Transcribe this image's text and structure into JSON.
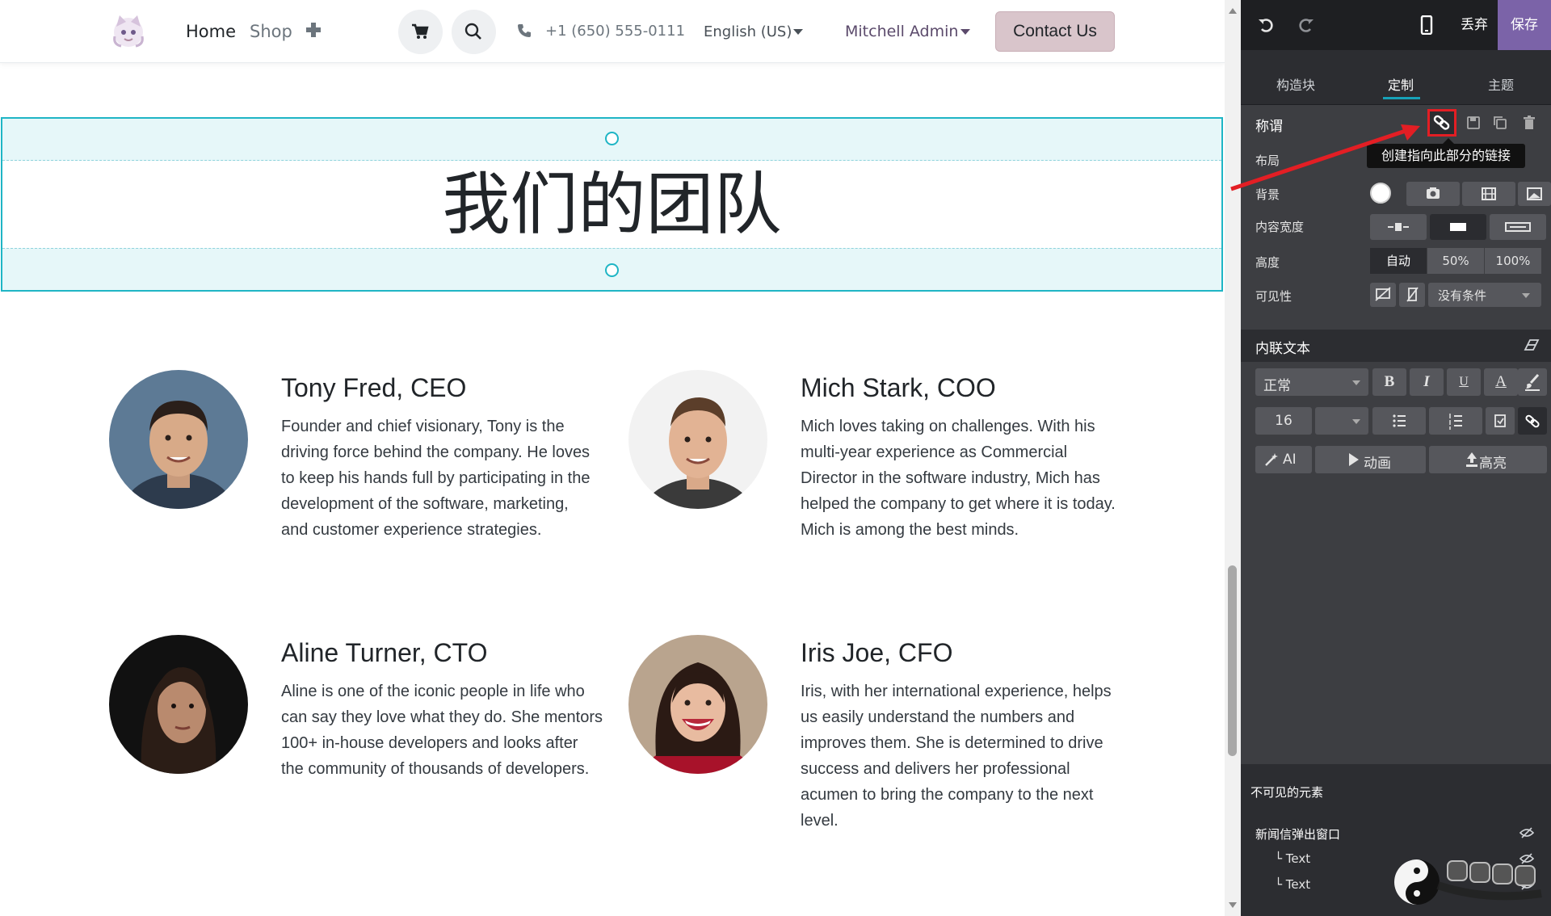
{
  "nav": {
    "home": "Home",
    "shop": "Shop",
    "phone": "+1 (650) 555-0111",
    "language": "English (US)",
    "user": "Mitchell Admin",
    "contact": "Contact Us",
    "icons": [
      "logo",
      "plus-icon",
      "cart-icon",
      "search-icon",
      "phone-icon",
      "caret-down-icon"
    ]
  },
  "section": {
    "title": "我们的团队"
  },
  "team": [
    {
      "name": "Tony Fred, CEO",
      "description": "Founder and chief visionary, Tony is the driving force behind the company. He loves to keep his hands full by participating in the development of the software, marketing, and customer experience strategies."
    },
    {
      "name": "Mich Stark, COO",
      "description": "Mich loves taking on challenges. With his multi-year experience as Commercial Director in the software industry, Mich has helped the company to get where it is today. Mich is among the best minds."
    },
    {
      "name": "Aline Turner, CTO",
      "description": "Aline is one of the iconic people in life who can say they love what they do. She mentors 100+ in-house developers and looks after the community of thousands of developers."
    },
    {
      "name": "Iris Joe, CFO",
      "description": "Iris, with her international experience, helps us easily understand the numbers and improves them. She is determined to drive success and delivers her professional acumen to bring the company to the next level."
    }
  ],
  "panel": {
    "discard": "丢弃",
    "save": "保存",
    "tabs": [
      "构造块",
      "定制",
      "主题"
    ],
    "options_title": "称谓",
    "tooltip": "创建指向此部分的链接",
    "labels": {
      "layout": "布局",
      "background": "背景",
      "content_width": "内容宽度",
      "height": "高度",
      "visibility": "可见性"
    },
    "height_options": [
      "自动",
      "50%",
      "100%"
    ],
    "visibility_value": "没有条件",
    "inline_text": "内联文本",
    "format_style": "正常",
    "format_buttons": [
      "B",
      "I",
      "U",
      "A"
    ],
    "font_size": "16",
    "ai": "AI",
    "animation": "动画",
    "highlight": "高亮",
    "invisible_title": "不可见的元素",
    "invisible_items": [
      "新闻信弹出窗口",
      "└ Text",
      "└ Text"
    ],
    "colors": {
      "accent": "#7b63a8",
      "selection": "#1fb5c5",
      "annotation": "#e31e24"
    }
  }
}
